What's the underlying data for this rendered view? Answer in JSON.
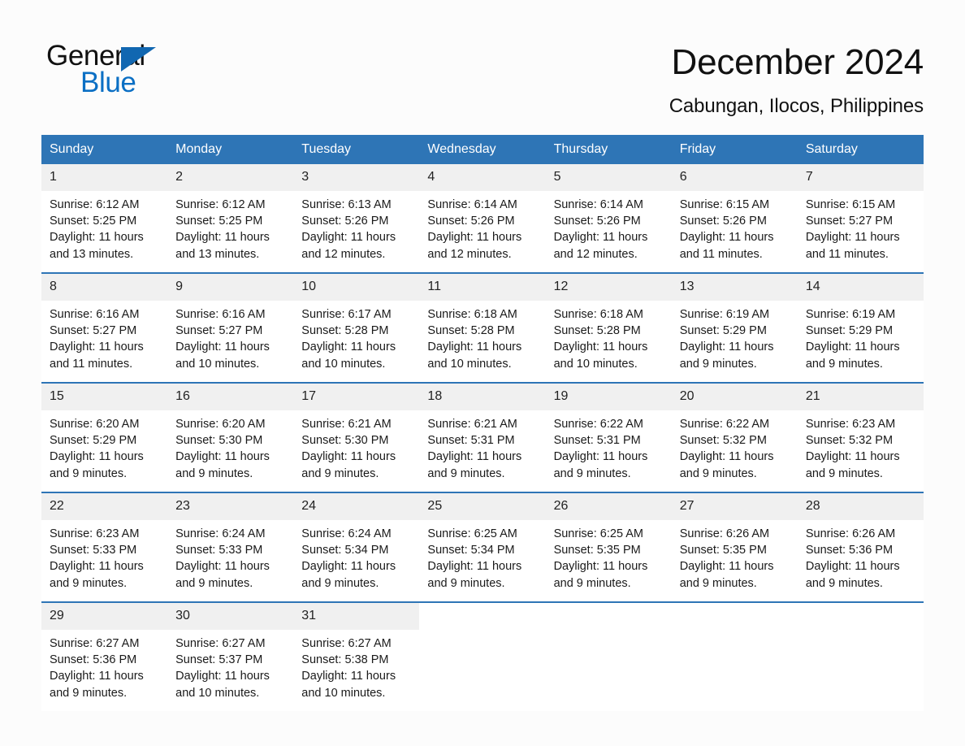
{
  "brand": {
    "name_top": "General",
    "name_bottom": "Blue",
    "triangle_icon": "triangle-icon",
    "accent_color": "#0b6fc4"
  },
  "header": {
    "title": "December 2024",
    "location": "Cabungan, Ilocos, Philippines"
  },
  "theme": {
    "header_blue": "#2e75b6",
    "daynum_gray": "#f0f0f0",
    "page_background": "#fcfcfc"
  },
  "calendar": {
    "weekday_headers": [
      "Sunday",
      "Monday",
      "Tuesday",
      "Wednesday",
      "Thursday",
      "Friday",
      "Saturday"
    ],
    "weeks": [
      [
        {
          "day": "1",
          "sunrise": "Sunrise: 6:12 AM",
          "sunset": "Sunset: 5:25 PM",
          "daylight": "Daylight: 11 hours and 13 minutes."
        },
        {
          "day": "2",
          "sunrise": "Sunrise: 6:12 AM",
          "sunset": "Sunset: 5:25 PM",
          "daylight": "Daylight: 11 hours and 13 minutes."
        },
        {
          "day": "3",
          "sunrise": "Sunrise: 6:13 AM",
          "sunset": "Sunset: 5:26 PM",
          "daylight": "Daylight: 11 hours and 12 minutes."
        },
        {
          "day": "4",
          "sunrise": "Sunrise: 6:14 AM",
          "sunset": "Sunset: 5:26 PM",
          "daylight": "Daylight: 11 hours and 12 minutes."
        },
        {
          "day": "5",
          "sunrise": "Sunrise: 6:14 AM",
          "sunset": "Sunset: 5:26 PM",
          "daylight": "Daylight: 11 hours and 12 minutes."
        },
        {
          "day": "6",
          "sunrise": "Sunrise: 6:15 AM",
          "sunset": "Sunset: 5:26 PM",
          "daylight": "Daylight: 11 hours and 11 minutes."
        },
        {
          "day": "7",
          "sunrise": "Sunrise: 6:15 AM",
          "sunset": "Sunset: 5:27 PM",
          "daylight": "Daylight: 11 hours and 11 minutes."
        }
      ],
      [
        {
          "day": "8",
          "sunrise": "Sunrise: 6:16 AM",
          "sunset": "Sunset: 5:27 PM",
          "daylight": "Daylight: 11 hours and 11 minutes."
        },
        {
          "day": "9",
          "sunrise": "Sunrise: 6:16 AM",
          "sunset": "Sunset: 5:27 PM",
          "daylight": "Daylight: 11 hours and 10 minutes."
        },
        {
          "day": "10",
          "sunrise": "Sunrise: 6:17 AM",
          "sunset": "Sunset: 5:28 PM",
          "daylight": "Daylight: 11 hours and 10 minutes."
        },
        {
          "day": "11",
          "sunrise": "Sunrise: 6:18 AM",
          "sunset": "Sunset: 5:28 PM",
          "daylight": "Daylight: 11 hours and 10 minutes."
        },
        {
          "day": "12",
          "sunrise": "Sunrise: 6:18 AM",
          "sunset": "Sunset: 5:28 PM",
          "daylight": "Daylight: 11 hours and 10 minutes."
        },
        {
          "day": "13",
          "sunrise": "Sunrise: 6:19 AM",
          "sunset": "Sunset: 5:29 PM",
          "daylight": "Daylight: 11 hours and 9 minutes."
        },
        {
          "day": "14",
          "sunrise": "Sunrise: 6:19 AM",
          "sunset": "Sunset: 5:29 PM",
          "daylight": "Daylight: 11 hours and 9 minutes."
        }
      ],
      [
        {
          "day": "15",
          "sunrise": "Sunrise: 6:20 AM",
          "sunset": "Sunset: 5:29 PM",
          "daylight": "Daylight: 11 hours and 9 minutes."
        },
        {
          "day": "16",
          "sunrise": "Sunrise: 6:20 AM",
          "sunset": "Sunset: 5:30 PM",
          "daylight": "Daylight: 11 hours and 9 minutes."
        },
        {
          "day": "17",
          "sunrise": "Sunrise: 6:21 AM",
          "sunset": "Sunset: 5:30 PM",
          "daylight": "Daylight: 11 hours and 9 minutes."
        },
        {
          "day": "18",
          "sunrise": "Sunrise: 6:21 AM",
          "sunset": "Sunset: 5:31 PM",
          "daylight": "Daylight: 11 hours and 9 minutes."
        },
        {
          "day": "19",
          "sunrise": "Sunrise: 6:22 AM",
          "sunset": "Sunset: 5:31 PM",
          "daylight": "Daylight: 11 hours and 9 minutes."
        },
        {
          "day": "20",
          "sunrise": "Sunrise: 6:22 AM",
          "sunset": "Sunset: 5:32 PM",
          "daylight": "Daylight: 11 hours and 9 minutes."
        },
        {
          "day": "21",
          "sunrise": "Sunrise: 6:23 AM",
          "sunset": "Sunset: 5:32 PM",
          "daylight": "Daylight: 11 hours and 9 minutes."
        }
      ],
      [
        {
          "day": "22",
          "sunrise": "Sunrise: 6:23 AM",
          "sunset": "Sunset: 5:33 PM",
          "daylight": "Daylight: 11 hours and 9 minutes."
        },
        {
          "day": "23",
          "sunrise": "Sunrise: 6:24 AM",
          "sunset": "Sunset: 5:33 PM",
          "daylight": "Daylight: 11 hours and 9 minutes."
        },
        {
          "day": "24",
          "sunrise": "Sunrise: 6:24 AM",
          "sunset": "Sunset: 5:34 PM",
          "daylight": "Daylight: 11 hours and 9 minutes."
        },
        {
          "day": "25",
          "sunrise": "Sunrise: 6:25 AM",
          "sunset": "Sunset: 5:34 PM",
          "daylight": "Daylight: 11 hours and 9 minutes."
        },
        {
          "day": "26",
          "sunrise": "Sunrise: 6:25 AM",
          "sunset": "Sunset: 5:35 PM",
          "daylight": "Daylight: 11 hours and 9 minutes."
        },
        {
          "day": "27",
          "sunrise": "Sunrise: 6:26 AM",
          "sunset": "Sunset: 5:35 PM",
          "daylight": "Daylight: 11 hours and 9 minutes."
        },
        {
          "day": "28",
          "sunrise": "Sunrise: 6:26 AM",
          "sunset": "Sunset: 5:36 PM",
          "daylight": "Daylight: 11 hours and 9 minutes."
        }
      ],
      [
        {
          "day": "29",
          "sunrise": "Sunrise: 6:27 AM",
          "sunset": "Sunset: 5:36 PM",
          "daylight": "Daylight: 11 hours and 9 minutes."
        },
        {
          "day": "30",
          "sunrise": "Sunrise: 6:27 AM",
          "sunset": "Sunset: 5:37 PM",
          "daylight": "Daylight: 11 hours and 10 minutes."
        },
        {
          "day": "31",
          "sunrise": "Sunrise: 6:27 AM",
          "sunset": "Sunset: 5:38 PM",
          "daylight": "Daylight: 11 hours and 10 minutes."
        },
        {
          "day": "",
          "sunrise": "",
          "sunset": "",
          "daylight": ""
        },
        {
          "day": "",
          "sunrise": "",
          "sunset": "",
          "daylight": ""
        },
        {
          "day": "",
          "sunrise": "",
          "sunset": "",
          "daylight": ""
        },
        {
          "day": "",
          "sunrise": "",
          "sunset": "",
          "daylight": ""
        }
      ]
    ]
  }
}
